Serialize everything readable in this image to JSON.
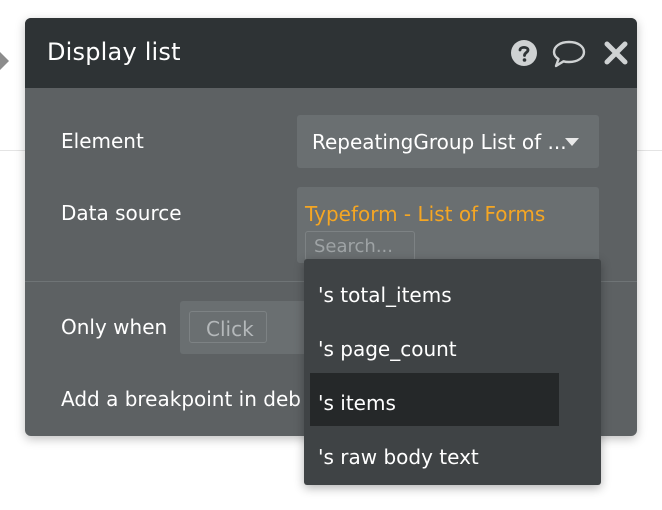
{
  "dialog": {
    "title": "Display list",
    "icons": [
      "help-icon",
      "chat-icon",
      "close-icon"
    ]
  },
  "fields": {
    "element_label": "Element",
    "element_value": "RepeatingGroup List of ...",
    "datasource_label": "Data source",
    "datasource_value": "Typeform - List of Forms",
    "search_placeholder": "Search...",
    "onlywhen_label": "Only when",
    "onlywhen_click": "Click",
    "breakpoint_label": "Add a breakpoint in deb"
  },
  "dropdown": {
    "items": [
      {
        "label": "'s total_items",
        "selected": false
      },
      {
        "label": "'s page_count",
        "selected": false
      },
      {
        "label": "'s items",
        "selected": true
      },
      {
        "label": "'s raw body text",
        "selected": false
      }
    ]
  },
  "colors": {
    "header_bg": "#2e3335",
    "panel_bg": "#5d6163",
    "field_bg": "#6a6f71",
    "dropdown_bg": "#3f4345",
    "selected_bg": "#252829",
    "accent_orange": "#f5a623"
  }
}
